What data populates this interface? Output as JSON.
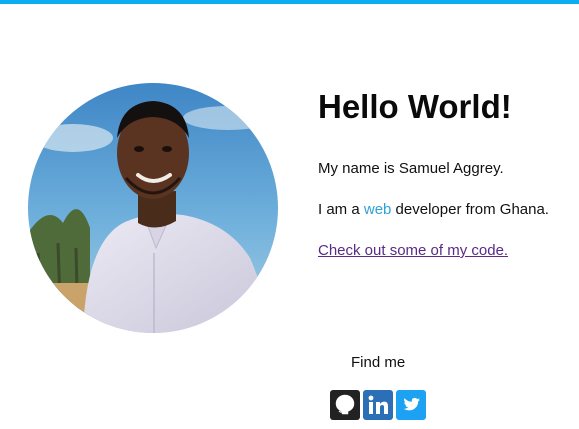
{
  "header": {
    "accent_color": "#0aaef0"
  },
  "profile": {
    "photo_alt": "Samuel Aggrey portrait"
  },
  "intro": {
    "title": "Hello World!",
    "name_line": "My name is Samuel Aggrey.",
    "role_prefix": "I am a ",
    "role_highlight": "web",
    "role_suffix": " developer from Ghana.",
    "code_link": "Check out some of my code.",
    "highlight_color": "#2ea1d8",
    "link_color": "#5a2a86"
  },
  "social": {
    "heading": "Find me",
    "links": [
      {
        "icon": "github-icon",
        "color": "#222222"
      },
      {
        "icon": "linkedin-icon",
        "color": "#2c6fb6"
      },
      {
        "icon": "twitter-icon",
        "color": "#1da1f2"
      }
    ]
  }
}
